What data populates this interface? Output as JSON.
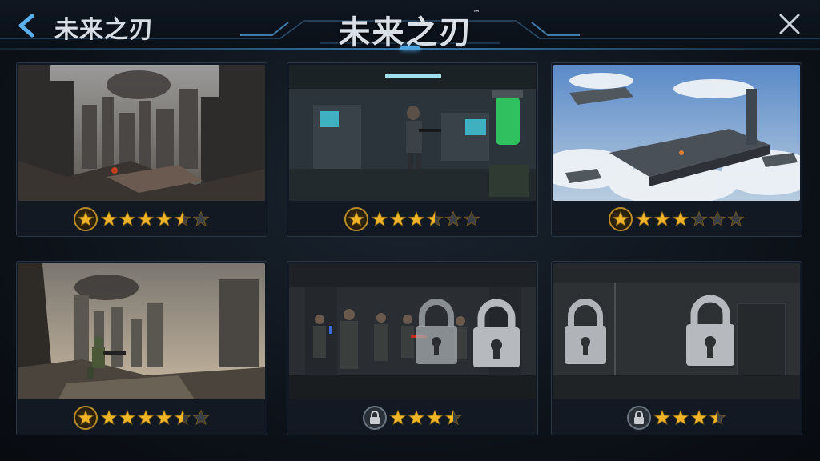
{
  "header": {
    "back_icon": "chevron-left-icon",
    "left_title": "未来之刃",
    "center_title": "未来之刃",
    "trademark": "™",
    "close_icon": "close-icon"
  },
  "levels": [
    {
      "scene": "ruined-city-skyline",
      "locked": false,
      "rating": 4.5,
      "max": 6,
      "badge": "star-badge"
    },
    {
      "scene": "laboratory-soldier",
      "locked": false,
      "rating": 3.5,
      "max": 6,
      "badge": "star-badge"
    },
    {
      "scene": "floating-sky-platforms",
      "locked": false,
      "rating": 3,
      "max": 6,
      "badge": "star-badge"
    },
    {
      "scene": "ruined-city-sniper",
      "locked": false,
      "rating": 4.5,
      "max": 6,
      "badge": "star-badge"
    },
    {
      "scene": "dark-corridor-squad",
      "locked": true,
      "rating": 3.5,
      "max": 4,
      "badge": "lock-badge"
    },
    {
      "scene": "dark-bunker-doors",
      "locked": true,
      "rating": 3.5,
      "max": 4,
      "badge": "lock-badge"
    }
  ],
  "colors": {
    "star_gold": "#f0b429",
    "star_empty": "#3a3f46",
    "accent": "#4aa4e0"
  }
}
